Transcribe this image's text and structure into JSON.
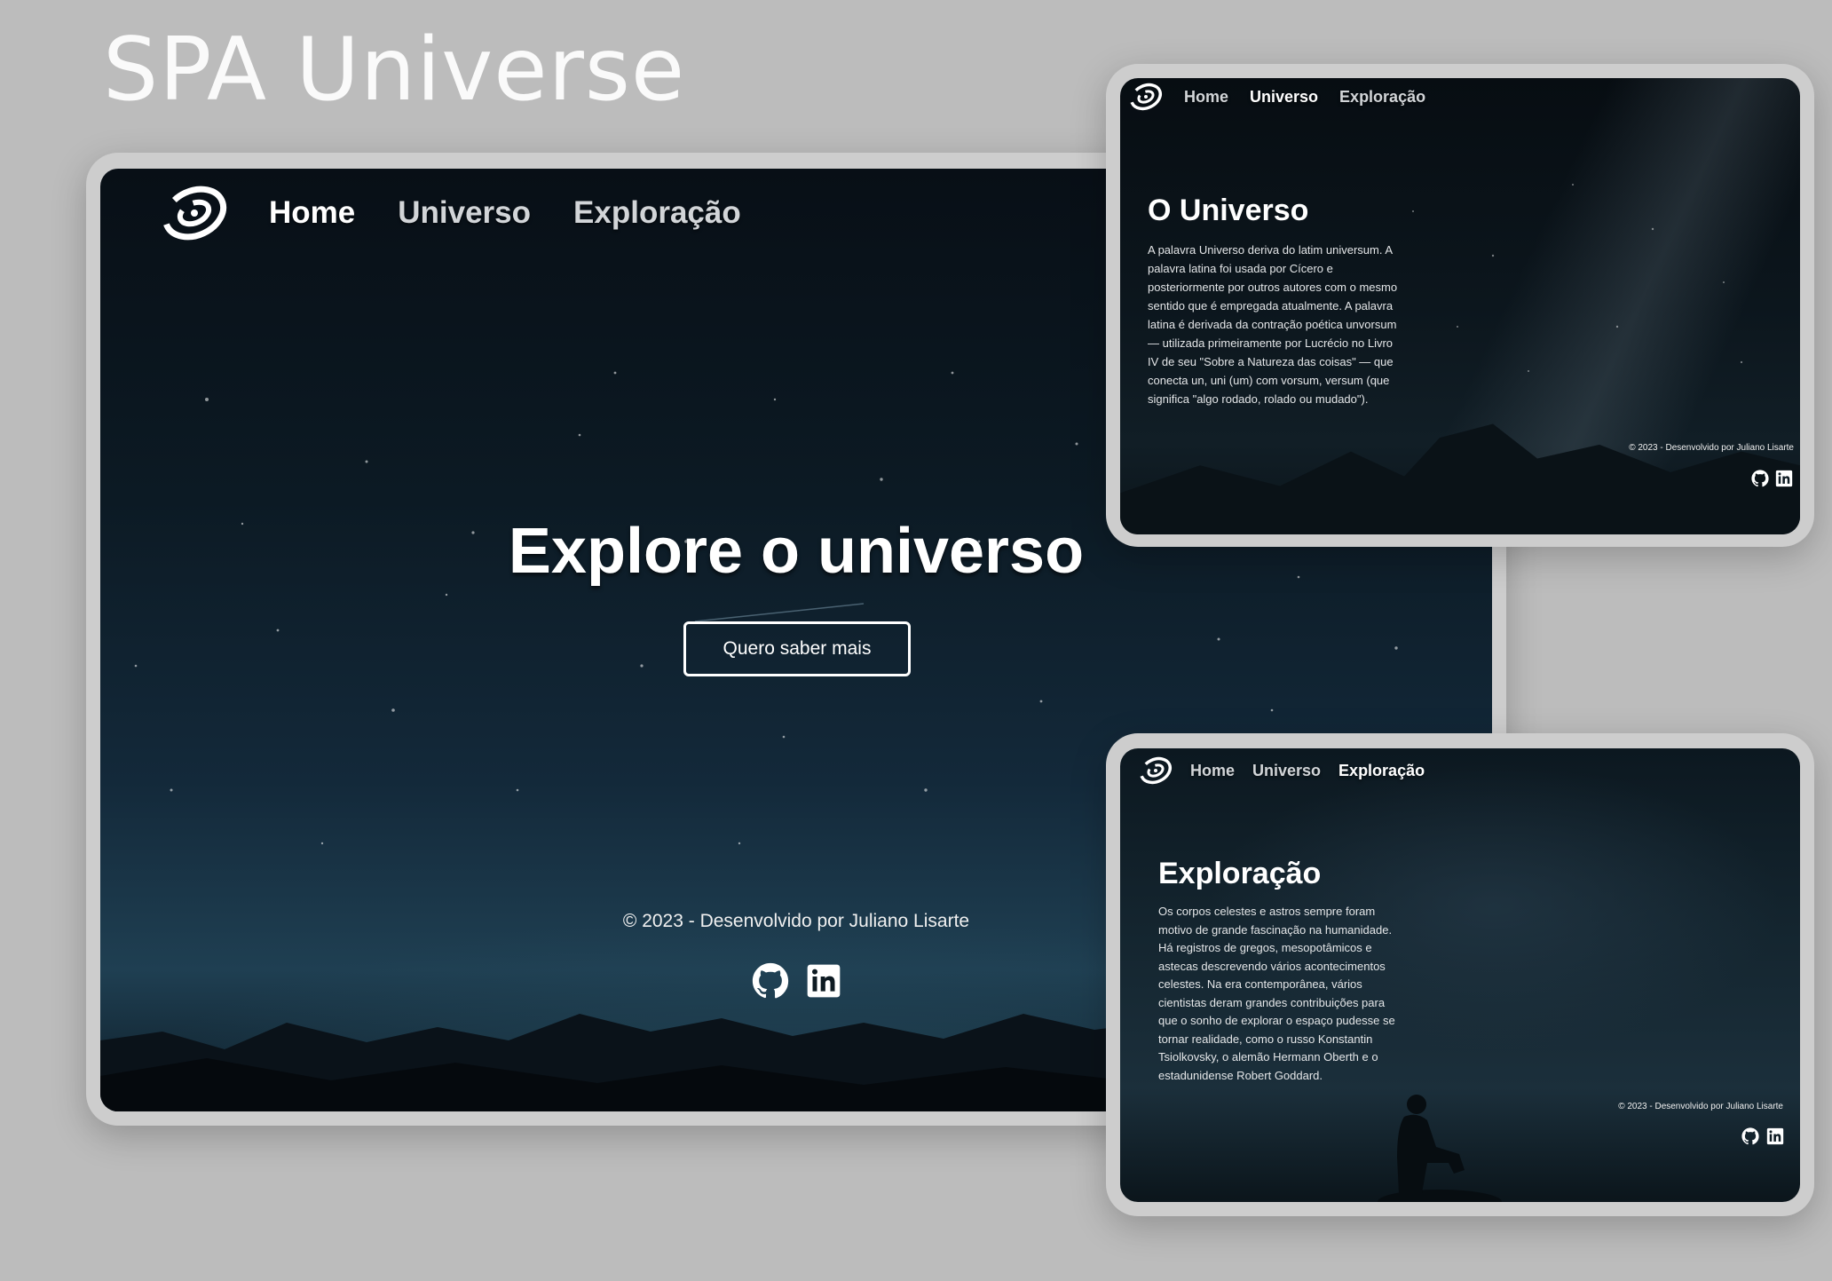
{
  "showcase": {
    "title": "SPA Universe"
  },
  "colors": {
    "page_background": "#bcbcbc",
    "frame": "#cdcdcd",
    "text": "#ffffff",
    "nav_inactive": "#d2d5d8"
  },
  "home": {
    "nav": {
      "items": [
        {
          "label": "Home",
          "active": true
        },
        {
          "label": "Universo",
          "active": false
        },
        {
          "label": "Exploração",
          "active": false
        }
      ]
    },
    "hero": {
      "title": "Explore o universo",
      "button_label": "Quero saber mais"
    },
    "footer": {
      "text": "© 2023 - Desenvolvido por Juliano Lisarte",
      "icons": [
        "github-icon",
        "linkedin-icon"
      ]
    }
  },
  "universe": {
    "nav": {
      "items": [
        {
          "label": "Home",
          "active": false
        },
        {
          "label": "Universo",
          "active": true
        },
        {
          "label": "Exploração",
          "active": false
        }
      ]
    },
    "title": "O Universo",
    "body": "A palavra Universo deriva do latim universum. A palavra latina foi usada por Cícero e posteriormente por outros autores com o mesmo sentido que é empregada atualmente. A palavra latina é derivada da contração poética unvorsum — utilizada primeiramente por Lucrécio no Livro IV de seu \"Sobre a Natureza das coisas\" — que conecta un, uni (um) com vorsum, versum (que significa \"algo rodado, rolado ou mudado\").",
    "footer": {
      "text": "© 2023 - Desenvolvido por Juliano Lisarte",
      "icons": [
        "github-icon",
        "linkedin-icon"
      ]
    }
  },
  "exploration": {
    "nav": {
      "items": [
        {
          "label": "Home",
          "active": false
        },
        {
          "label": "Universo",
          "active": false
        },
        {
          "label": "Exploração",
          "active": true
        }
      ]
    },
    "title": "Exploração",
    "body": "Os corpos celestes e astros sempre foram motivo de grande fascinação na humanidade. Há registros de gregos, mesopotâmicos e astecas descrevendo vários acontecimentos celestes. Na era contemporânea, vários cientistas deram grandes contribuições para que o sonho de explorar o espaço pudesse se tornar realidade, como o russo Konstantin Tsiolkovsky, o alemão Hermann Oberth e o estadunidense Robert Goddard.",
    "footer": {
      "text": "© 2023 - Desenvolvido por Juliano Lisarte",
      "icons": [
        "github-icon",
        "linkedin-icon"
      ]
    }
  }
}
